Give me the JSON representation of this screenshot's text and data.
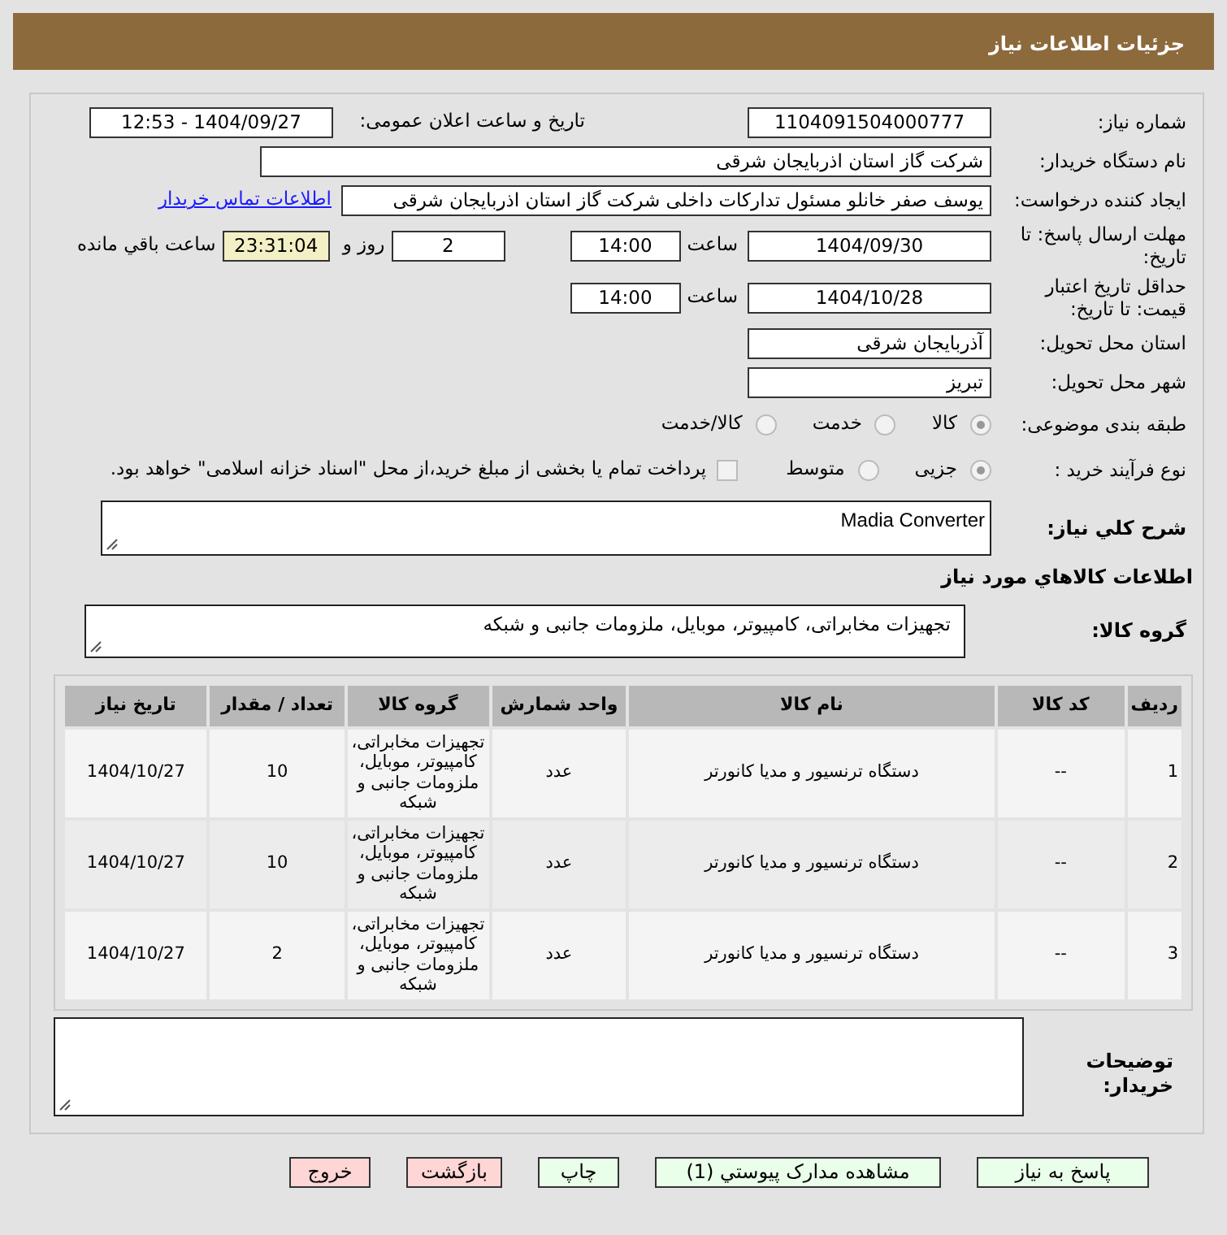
{
  "header": {
    "title": "جزئیات اطلاعات نیاز"
  },
  "fields": {
    "need_number": {
      "label": "شماره نیاز:",
      "value": "1104091504000777"
    },
    "announce": {
      "label": "تاریخ و ساعت اعلان عمومی:",
      "value": "1404/09/27 - 12:53"
    },
    "buyer": {
      "label": "نام دستگاه خریدار:",
      "value": "شرکت گاز استان اذربایجان شرقی"
    },
    "creator": {
      "label": "ایجاد کننده درخواست:",
      "value": "یوسف صفر خانلو  مسئول تدارکات داخلی  شرکت گاز استان اذربایجان شرقی",
      "link": "اطلاعات تماس خریدار"
    },
    "deadline": {
      "label": "مهلت ارسال پاسخ: تا تاریخ:",
      "date": "1404/09/30",
      "time_label": "ساعت",
      "time": "14:00",
      "days": "2",
      "days_label": "روز و",
      "remaining": "23:31:04",
      "remaining_label": "ساعت باقي مانده"
    },
    "validity": {
      "label": "حداقل تاریخ اعتبار قیمت: تا تاریخ:",
      "date": "1404/10/28",
      "time_label": "ساعت",
      "time": "14:00"
    },
    "province": {
      "label": "استان محل تحویل:",
      "value": "آذربایجان شرقی"
    },
    "city": {
      "label": "شهر محل تحویل:",
      "value": "تبریز"
    }
  },
  "category": {
    "label": "طبقه بندی موضوعی:",
    "options": [
      {
        "label": "کالا",
        "selected": true
      },
      {
        "label": "خدمت",
        "selected": false
      },
      {
        "label": "کالا/خدمت",
        "selected": false
      }
    ]
  },
  "process": {
    "label": "نوع فرآیند خرید :",
    "options": [
      {
        "label": "جزیی",
        "selected": true
      },
      {
        "label": "متوسط",
        "selected": false
      }
    ],
    "payment": {
      "checked": false,
      "text": "پرداخت تمام یا بخشی از مبلغ خرید،از محل \"اسناد خزانه اسلامی\" خواهد بود."
    }
  },
  "description": {
    "label": "شرح کلي نیاز:",
    "value": "Madia Converter"
  },
  "goods_title": "اطلاعات کالاهاي مورد نیاز",
  "goods_group": {
    "label": "گروه کالا:",
    "value": "تجهیزات مخابراتی، کامپیوتر، موبایل، ملزومات جانبی و شبکه"
  },
  "table": {
    "columns": [
      "ردیف",
      "کد کالا",
      "نام کالا",
      "واحد شمارش",
      "گروه کالا",
      "تعداد / مقدار",
      "تاریخ نیاز"
    ],
    "rows": [
      [
        "1",
        "--",
        "دستگاه ترنسیور و مدیا کانورتر",
        "عدد",
        "تجهیزات مخابراتی، کامپیوتر، موبایل، ملزومات جانبی و شبکه",
        "10",
        "1404/10/27"
      ],
      [
        "2",
        "--",
        "دستگاه ترنسیور و مدیا کانورتر",
        "عدد",
        "تجهیزات مخابراتی، کامپیوتر، موبایل، ملزومات جانبی و شبکه",
        "10",
        "1404/10/27"
      ],
      [
        "3",
        "--",
        "دستگاه ترنسیور و مدیا کانورتر",
        "عدد",
        "تجهیزات مخابراتی، کامپیوتر، موبایل، ملزومات جانبی و شبکه",
        "2",
        "1404/10/27"
      ]
    ]
  },
  "notes": {
    "label": "توضیحات خریدار:"
  },
  "buttons": [
    {
      "label": "پاسخ به نیاز",
      "kind": "go"
    },
    {
      "label": "مشاهده مدارک پیوستي (1)",
      "kind": "go"
    },
    {
      "label": "چاپ",
      "kind": "go"
    },
    {
      "label": "بازگشت",
      "kind": "stop"
    },
    {
      "label": "خروج",
      "kind": "stop"
    }
  ]
}
